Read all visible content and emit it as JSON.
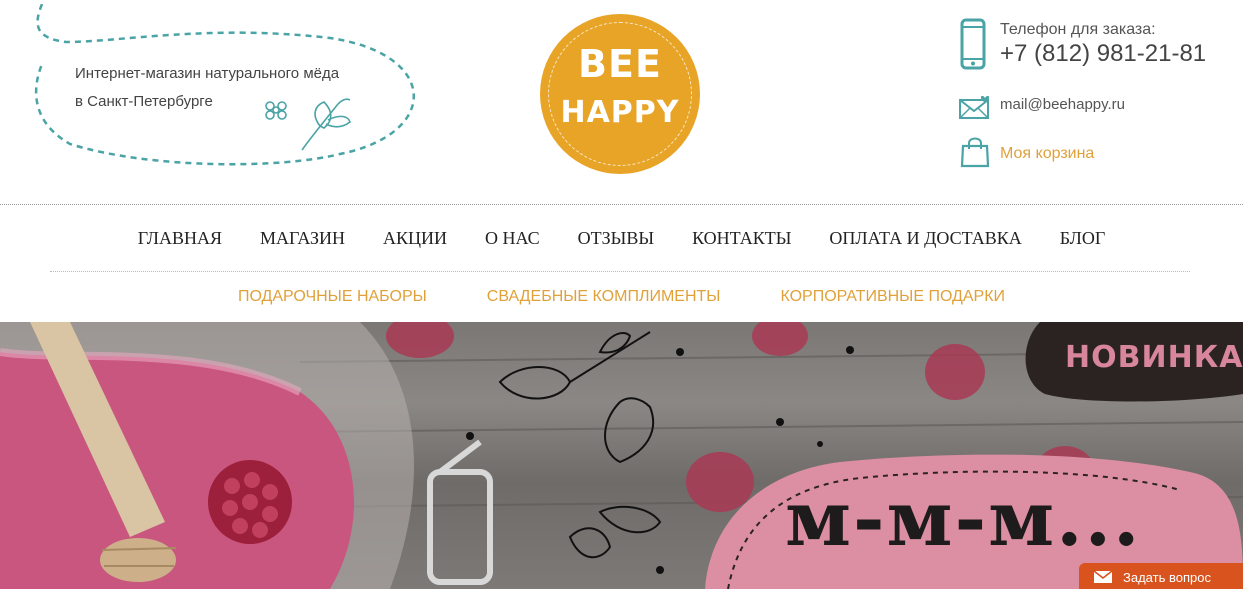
{
  "header": {
    "tagline_line1": "Интернет-магазин натурального мёда",
    "tagline_line2": "в Санкт-Петербурге",
    "logo_line1": "BEE",
    "logo_line2": "HAPPY",
    "phone_label": "Телефон для заказа:",
    "phone_number": "+7 (812) 981-21-81",
    "email": "mail@beehappy.ru",
    "cart_label": "Моя корзина"
  },
  "nav": {
    "items": [
      "ГЛАВНАЯ",
      "МАГАЗИН",
      "АКЦИИ",
      "О НАС",
      "ОТЗЫВЫ",
      "КОНТАКТЫ",
      "ОПЛАТА И ДОСТАВКА",
      "БЛОГ"
    ]
  },
  "subnav": {
    "items": [
      "ПОДАРОЧНЫЕ НАБОРЫ",
      "СВАДЕБНЫЕ КОМПЛИМЕНТЫ",
      "КОРПОРАТИВНЫЕ ПОДАРКИ"
    ]
  },
  "hero": {
    "badge_text": "НОВИНКА!",
    "headline": "м-м-м..."
  },
  "widget": {
    "ask_label": "Задать вопрос"
  },
  "colors": {
    "accent_orange": "#e8a427",
    "link_orange": "#e0a13a",
    "teal": "#4aa3a5",
    "ask_button": "#d9531e",
    "badge_pink": "#d7869c"
  },
  "icons": {
    "phone": "phone-icon",
    "mail": "mail-icon",
    "cart": "cart-icon",
    "envelope": "envelope-icon",
    "flower": "flower-icon"
  }
}
